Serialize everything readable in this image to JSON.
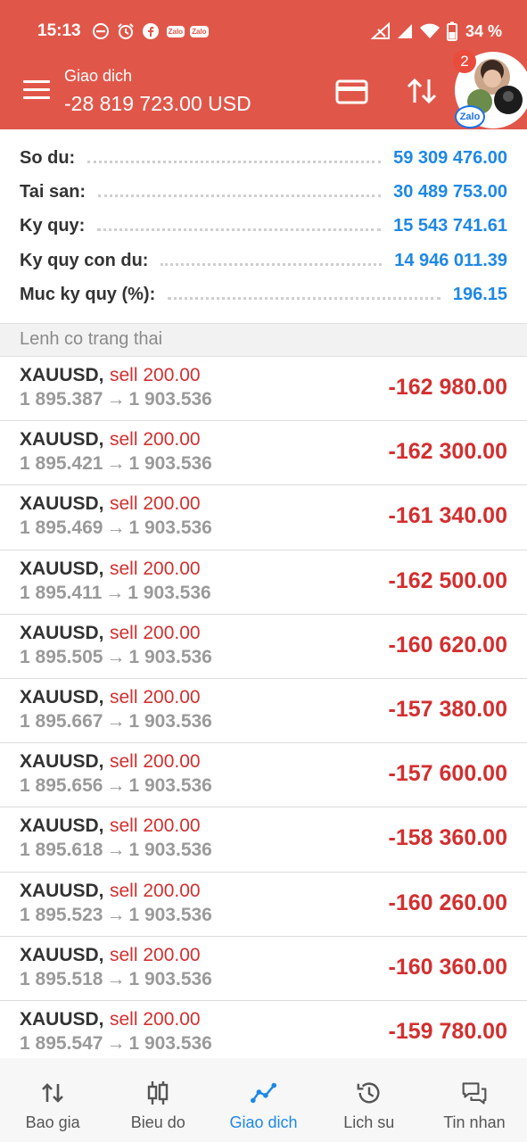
{
  "status_bar": {
    "time": "15:13",
    "battery": "34 %",
    "zalo_label": "Zalo"
  },
  "app_bar": {
    "title": "Giao dich",
    "balance": "-28 819 723.00 USD"
  },
  "chat_head": {
    "count": "2",
    "app": "Zalo"
  },
  "summary": [
    {
      "label": "So du:",
      "value": "59 309 476.00"
    },
    {
      "label": "Tai san:",
      "value": "30 489 753.00"
    },
    {
      "label": "Ky quy:",
      "value": "15 543 741.61"
    },
    {
      "label": "Ky quy con du:",
      "value": "14 946 011.39"
    },
    {
      "label": "Muc ky quy (%):",
      "value": "196.15"
    }
  ],
  "section_title": "Lenh co trang thai",
  "positions": [
    {
      "symbol": "XAUUSD,",
      "side": "sell 200.00",
      "open": "1 895.387",
      "current": "1 903.536",
      "profit": "-162 980.00"
    },
    {
      "symbol": "XAUUSD,",
      "side": "sell 200.00",
      "open": "1 895.421",
      "current": "1 903.536",
      "profit": "-162 300.00"
    },
    {
      "symbol": "XAUUSD,",
      "side": "sell 200.00",
      "open": "1 895.469",
      "current": "1 903.536",
      "profit": "-161 340.00"
    },
    {
      "symbol": "XAUUSD,",
      "side": "sell 200.00",
      "open": "1 895.411",
      "current": "1 903.536",
      "profit": "-162 500.00"
    },
    {
      "symbol": "XAUUSD,",
      "side": "sell 200.00",
      "open": "1 895.505",
      "current": "1 903.536",
      "profit": "-160 620.00"
    },
    {
      "symbol": "XAUUSD,",
      "side": "sell 200.00",
      "open": "1 895.667",
      "current": "1 903.536",
      "profit": "-157 380.00"
    },
    {
      "symbol": "XAUUSD,",
      "side": "sell 200.00",
      "open": "1 895.656",
      "current": "1 903.536",
      "profit": "-157 600.00"
    },
    {
      "symbol": "XAUUSD,",
      "side": "sell 200.00",
      "open": "1 895.618",
      "current": "1 903.536",
      "profit": "-158 360.00"
    },
    {
      "symbol": "XAUUSD,",
      "side": "sell 200.00",
      "open": "1 895.523",
      "current": "1 903.536",
      "profit": "-160 260.00"
    },
    {
      "symbol": "XAUUSD,",
      "side": "sell 200.00",
      "open": "1 895.518",
      "current": "1 903.536",
      "profit": "-160 360.00"
    },
    {
      "symbol": "XAUUSD,",
      "side": "sell 200.00",
      "open": "1 895.547",
      "current": "1 903.536",
      "profit": "-159 780.00"
    }
  ],
  "arrow_glyph": "→",
  "bottom_nav": [
    {
      "label": "Bao gia",
      "icon": "quotes-icon"
    },
    {
      "label": "Bieu do",
      "icon": "chart-candles-icon"
    },
    {
      "label": "Giao dich",
      "icon": "trade-icon",
      "active": true
    },
    {
      "label": "Lich su",
      "icon": "history-icon"
    },
    {
      "label": "Tin nhan",
      "icon": "messages-icon"
    }
  ],
  "colors": {
    "header": "#e0574a",
    "accent_blue": "#1e88e5",
    "loss_red": "#d32f2f"
  }
}
